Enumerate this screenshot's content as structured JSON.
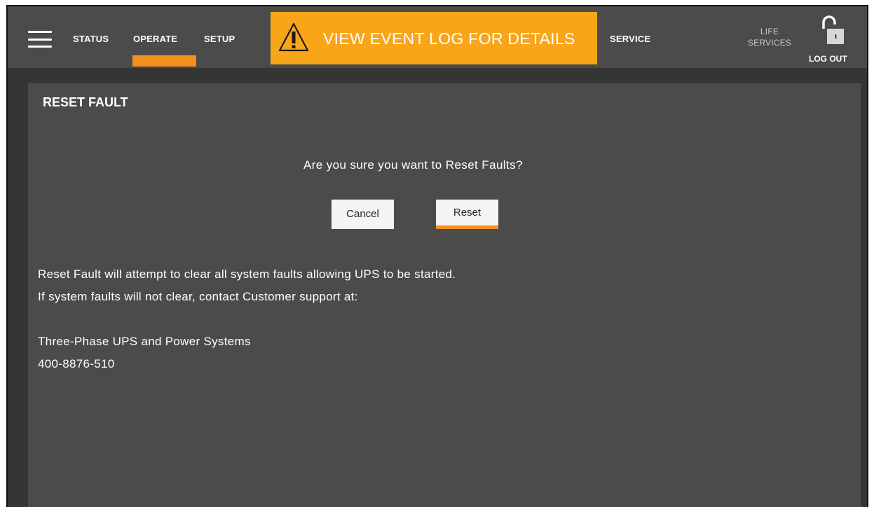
{
  "nav": {
    "status": "STATUS",
    "operate": "OPERATE",
    "setup": "SETUP",
    "service": "SERVICE",
    "life_services_line1": "LIFE",
    "life_services_line2": "SERVICES",
    "active_tab": "OPERATE"
  },
  "alert": {
    "text": "VIEW EVENT LOG FOR DETAILS",
    "icon": "warning-triangle-icon"
  },
  "logout": {
    "label": "LOG OUT",
    "icon": "unlocked-padlock-icon"
  },
  "panel": {
    "title": "RESET FAULT",
    "question": "Are you sure you want to Reset Faults?",
    "cancel_label": "Cancel",
    "reset_label": "Reset",
    "line1": "Reset Fault will attempt to clear all system faults allowing UPS to be started.",
    "line2": "If system faults will not clear, contact Customer support at:",
    "company": "Three-Phase UPS and Power Systems",
    "phone": "400-8876-510"
  },
  "colors": {
    "accent": "#f5901e",
    "alert_bg": "#f9a51a",
    "topbar_bg": "#4b4b4b",
    "panel_bg": "#4b4b4b",
    "frame_bg": "#353535"
  }
}
